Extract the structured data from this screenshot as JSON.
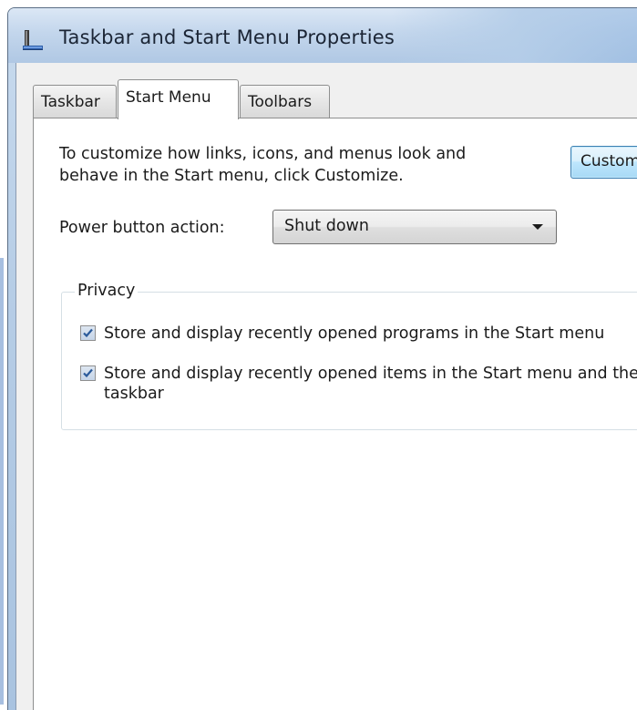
{
  "window": {
    "title": "Taskbar and Start Menu Properties",
    "icon": "taskbar-app-icon"
  },
  "tabs": [
    {
      "label": "Taskbar",
      "selected": false
    },
    {
      "label": "Start Menu",
      "selected": true
    },
    {
      "label": "Toolbars",
      "selected": false
    }
  ],
  "start_menu": {
    "description_line1": "To customize how links, icons, and menus look and",
    "description_line2": "behave in the Start menu, click Customize.",
    "customize_button_label": "Customize...",
    "power_button_label": "Power button action:",
    "power_button_value": "Shut down",
    "privacy": {
      "legend": "Privacy",
      "store_programs_label": "Store and display recently opened programs in the Start menu",
      "store_programs_checked": true,
      "store_items_label": "Store and display recently opened items in the Start menu and the",
      "store_items_label_line2": "taskbar",
      "store_items_checked": true
    }
  },
  "colors": {
    "title_bar": "#c3d6ec",
    "button_hover": "#bee6fd",
    "checkbox_check": "#2a5a9a"
  }
}
